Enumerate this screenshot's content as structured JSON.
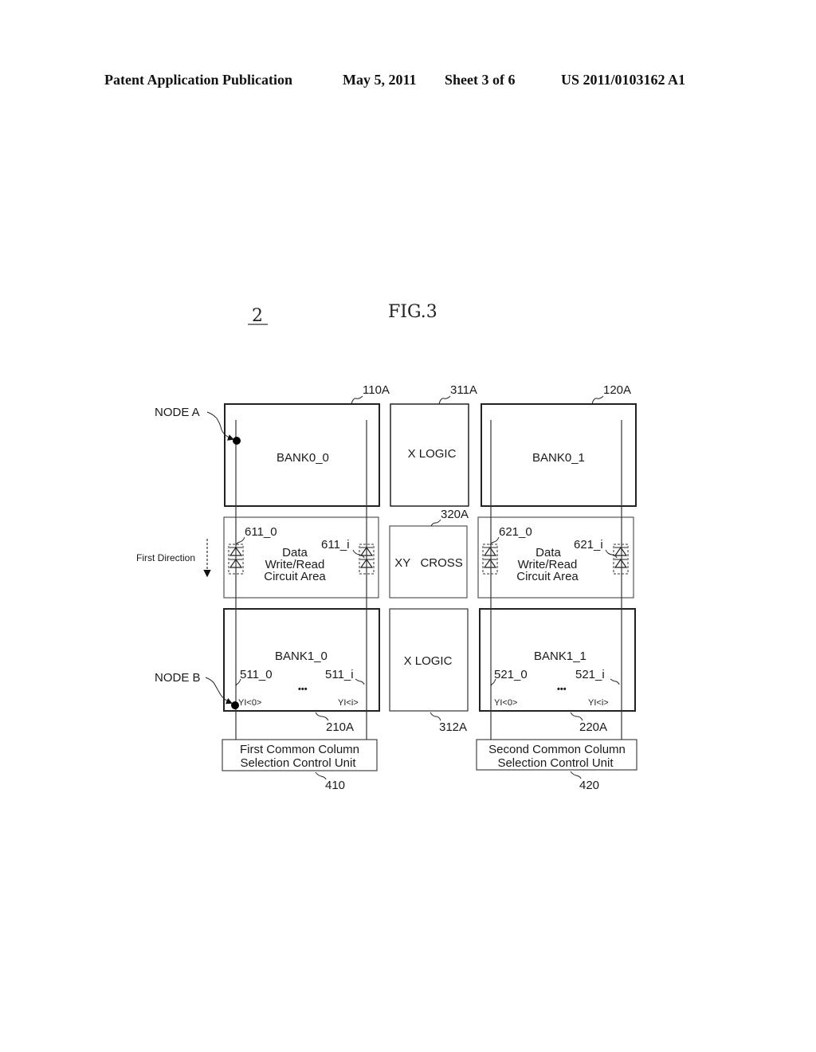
{
  "header": {
    "publication": "Patent Application Publication",
    "date": "May 5, 2011",
    "sheet": "Sheet 3 of 6",
    "number": "US 2011/0103162 A1"
  },
  "figure": {
    "title": "FIG.3",
    "ref": "2",
    "direction_label": "First Direction",
    "node_a": "NODE A",
    "node_b": "NODE B",
    "bank0_0": {
      "label": "BANK0_0",
      "ref": "110A"
    },
    "bank0_1": {
      "label": "BANK0_1",
      "ref": "120A"
    },
    "bank1_0": {
      "label": "BANK1_0",
      "ref": "210A",
      "col0": "511_0",
      "coli": "511_i",
      "yi0": "YI<0>",
      "yii": "YI<i>",
      "ellipsis": "•••"
    },
    "bank1_1": {
      "label": "BANK1_1",
      "ref": "220A",
      "col0": "521_0",
      "coli": "521_i",
      "yi0": "YI<0>",
      "yii": "YI<i>",
      "ellipsis": "•••"
    },
    "xlogic_top": {
      "label": "X LOGIC",
      "ref": "311A"
    },
    "xlogic_bottom": {
      "label": "X LOGIC",
      "ref": "312A"
    },
    "xycross": {
      "label": "XY   CROSS",
      "ref": "320A"
    },
    "wr_left": {
      "line1": "Data",
      "line2": "Write/Read",
      "line3": "Circuit Area",
      "amp0": "611_0",
      "ampi": "611_i"
    },
    "wr_right": {
      "line1": "Data",
      "line2": "Write/Read",
      "line3": "Circuit Area",
      "amp0": "621_0",
      "ampi": "621_i"
    },
    "ctrl_first": {
      "line1": "First Common Column",
      "line2": "Selection Control Unit",
      "ref": "410"
    },
    "ctrl_second": {
      "line1": "Second Common Column",
      "line2": "Selection Control Unit",
      "ref": "420"
    }
  }
}
